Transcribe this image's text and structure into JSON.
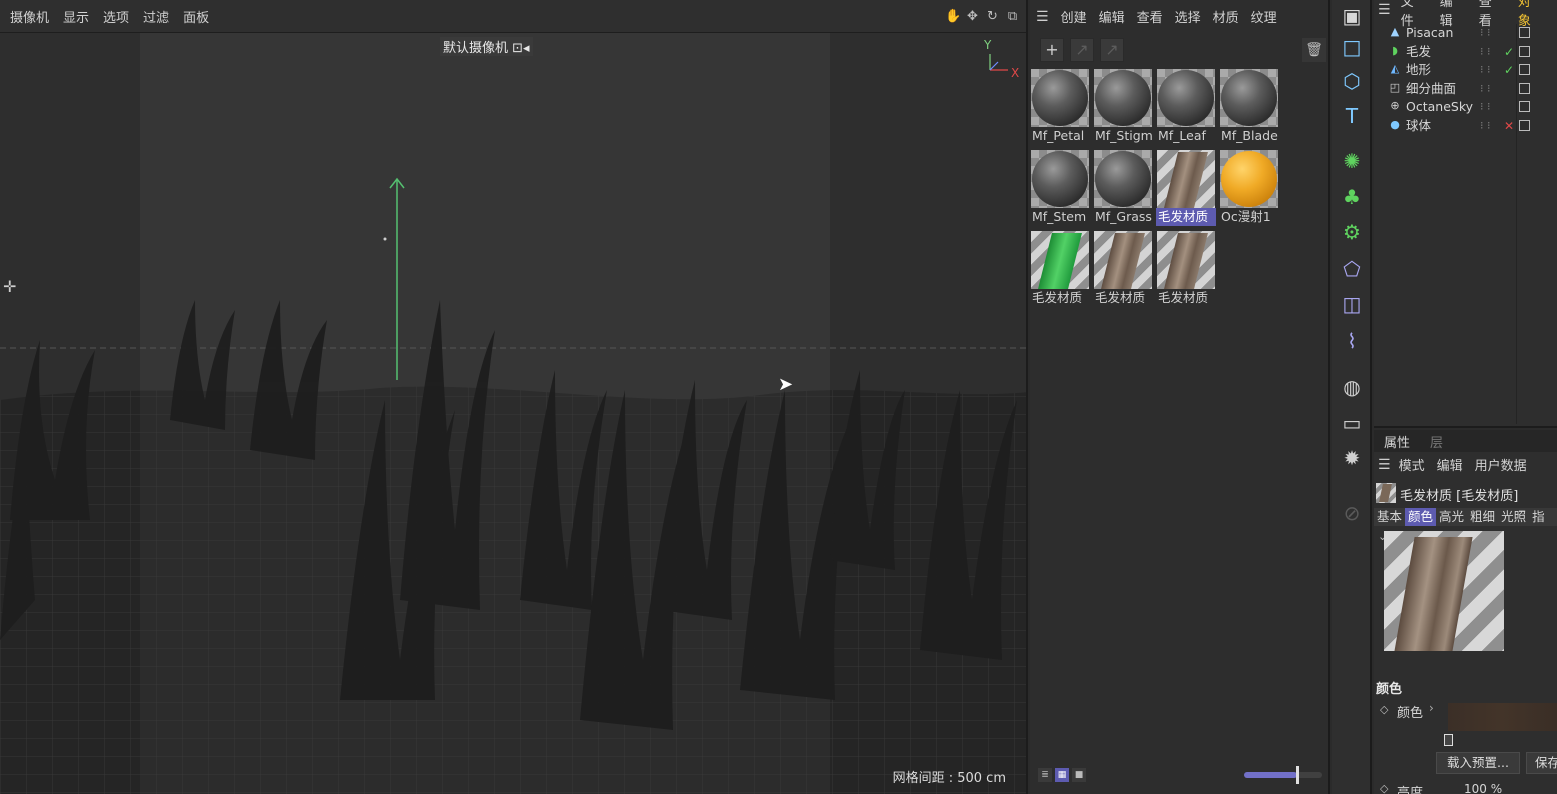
{
  "viewport": {
    "menu": [
      "摄像机",
      "显示",
      "选项",
      "过滤",
      "面板"
    ],
    "camera_label": "默认摄像机 ⊡◂",
    "grid_distance": "网格间距 : 500 cm",
    "axis_y": "Y",
    "axis_x": "X",
    "nav_icons": [
      "hand-pan-icon",
      "move-arrows-icon",
      "rotate-icon",
      "maximize-icon"
    ]
  },
  "material_manager": {
    "menu": [
      "创建",
      "编辑",
      "查看",
      "选择",
      "材质",
      "纹理"
    ],
    "materials": [
      {
        "name": "Mf_Petal",
        "kind": "sphere"
      },
      {
        "name": "Mf_Stigm",
        "kind": "sphere"
      },
      {
        "name": "Mf_Leaf",
        "kind": "sphere"
      },
      {
        "name": "Mf_Blade",
        "kind": "sphere"
      },
      {
        "name": "Mf_Stem",
        "kind": "sphere"
      },
      {
        "name": "Mf_Grass",
        "kind": "sphere"
      },
      {
        "name": "毛发材质",
        "kind": "hair",
        "selected": true
      },
      {
        "name": "Oc漫射1",
        "kind": "orange"
      },
      {
        "name": "毛发材质",
        "kind": "hair-green"
      },
      {
        "name": "毛发材质",
        "kind": "hair"
      },
      {
        "name": "毛发材质",
        "kind": "hair"
      }
    ],
    "zoom_level": 0.68
  },
  "object_manager": {
    "menu": [
      "文件",
      "编辑",
      "查看",
      "对象"
    ],
    "objects": [
      {
        "name": "Pisacan",
        "icon": "pisacan-icon",
        "glyph": "▲",
        "color": "#9fd3ff",
        "tag": "",
        "tag_color": "#9fd3ff"
      },
      {
        "name": "毛发",
        "icon": "hair-object-icon",
        "glyph": "◗",
        "color": "#5fd35f",
        "tag": "✓",
        "tag_color": "#5fd35f"
      },
      {
        "name": "地形",
        "icon": "landscape-icon",
        "glyph": "◭",
        "color": "#6fb8ff",
        "tag": "✓",
        "tag_color": "#5fd35f"
      },
      {
        "name": "细分曲面",
        "icon": "subdivision-icon",
        "glyph": "◰",
        "color": "#cfcfcf",
        "tag": "",
        "tag_color": "#cfcfcf"
      },
      {
        "name": "OctaneSky",
        "icon": "octanesky-icon",
        "glyph": "⊕",
        "color": "#cfcfcf",
        "tag": "",
        "tag_color": "#cfcfcf"
      },
      {
        "name": "球体",
        "icon": "sphere-icon",
        "glyph": "●",
        "color": "#7fc9ff",
        "tag": "✕",
        "tag_color": "#e04848"
      }
    ]
  },
  "attributes": {
    "tabs": [
      "属性",
      "层"
    ],
    "menu": [
      "模式",
      "编辑",
      "用户数据"
    ],
    "title": "毛发材质 [毛发材质]",
    "channels": [
      "基本",
      "颜色",
      "高光",
      "粗细",
      "光照",
      "指"
    ],
    "active_channel": "颜色",
    "section": "颜色",
    "color_label": "颜色",
    "load_preset": "载入预置...",
    "save_preset": "保存",
    "brightness_label": "亮度",
    "brightness_value": "100 %",
    "color_value": "#433429"
  },
  "vtoolbar": {
    "icons": [
      {
        "name": "render-view-icon",
        "glyph": "▣",
        "color": "#d8d8d8"
      },
      {
        "name": "square-icon",
        "glyph": "□",
        "color": "#7fc9ff"
      },
      {
        "name": "cube-icon",
        "glyph": "⬡",
        "color": "#7fc9ff"
      },
      {
        "name": "text-icon",
        "glyph": "T",
        "color": "#7fc9ff"
      },
      {
        "name": "nurbs-icon",
        "glyph": "✺",
        "color": "#5fd35f"
      },
      {
        "name": "array-icon",
        "glyph": "♣",
        "color": "#5fd35f"
      },
      {
        "name": "gear-deformer-icon",
        "glyph": "⚙",
        "color": "#5fd35f"
      },
      {
        "name": "deformer-icon",
        "glyph": "⬠",
        "color": "#a8a6f0"
      },
      {
        "name": "scene-box-icon",
        "glyph": "◫",
        "color": "#a8a6f0"
      },
      {
        "name": "spline-pen-icon",
        "glyph": "⌇",
        "color": "#a8a6f0"
      },
      {
        "name": "environment-globe-icon",
        "glyph": "◍",
        "color": "#cfcfcf"
      },
      {
        "name": "camera-icon",
        "glyph": "▭",
        "color": "#cfcfcf"
      },
      {
        "name": "light-bulb-icon",
        "glyph": "✹",
        "color": "#cfcfcf"
      },
      {
        "name": "disabled-tool-icon",
        "glyph": "⊘",
        "color": "#5a5a5a"
      }
    ]
  }
}
